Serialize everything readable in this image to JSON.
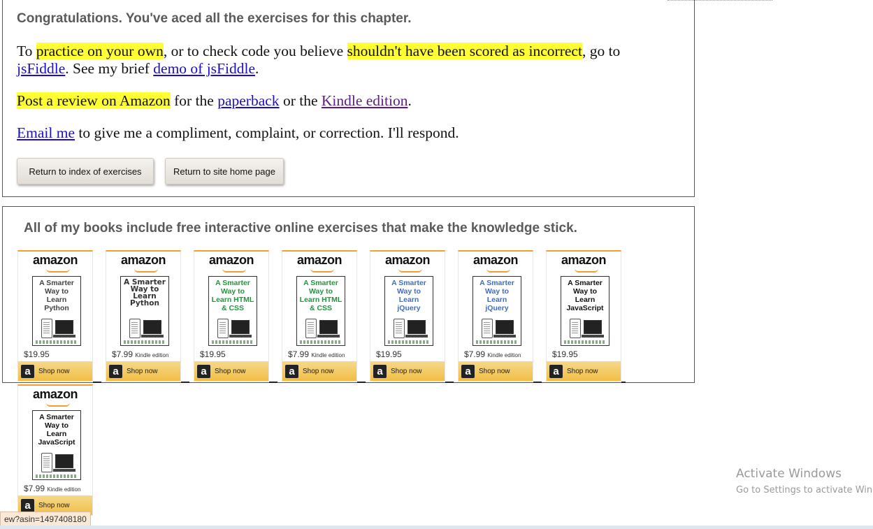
{
  "result": {
    "congrats": "Congratulations. You've aced all the exercises for this chapter.",
    "p1_to": "To ",
    "p1_practice": "practice on your own",
    "p1_mid": ", or to check code you believe ",
    "p1_incorrect": "shouldn't have been scored as incorrect",
    "p1_goto": ", go to",
    "p1_jsfiddle": "jsFiddle",
    "p1_see": ". See my brief ",
    "p1_demo": "demo of jsFiddle",
    "p1_end": ".",
    "p2_review": "Post a review on Amazon",
    "p2_for": " for the ",
    "p2_paperback": "paperback",
    "p2_or": " or the ",
    "p2_kindle": "Kindle edition",
    "p2_end": ".",
    "p3_email": "Email me",
    "p3_rest": " to give me a compliment, complaint, or correction. I'll respond.",
    "btn_index": "Return to index of exercises",
    "btn_home": "Return to site home page"
  },
  "books": {
    "heading": "All of my books include free interactive online exercises that make the knowledge stick.",
    "logo": "amazon",
    "shop_label": "Shop now",
    "items": [
      {
        "title": "A Smarter Way to Learn Python",
        "price": "$19.95",
        "edition": "",
        "color": "#444444"
      },
      {
        "title": "A Smarter Way to Learn Python",
        "price": "$7.99",
        "edition": "Kindle edition",
        "color": "#333333"
      },
      {
        "title": "A Smarter Way to Learn HTML & CSS",
        "price": "$19.95",
        "edition": "",
        "color": "#1a9a3a"
      },
      {
        "title": "A Smarter Way to Learn HTML & CSS",
        "price": "$7.99",
        "edition": "Kindle edition",
        "color": "#1a9a3a"
      },
      {
        "title": "A Smarter Way to Learn jQuery",
        "price": "$19.95",
        "edition": "",
        "color": "#3a6ec8"
      },
      {
        "title": "A Smarter Way to Learn jQuery",
        "price": "$7.99",
        "edition": "Kindle edition",
        "color": "#3a6ec8"
      },
      {
        "title": "A Smarter Way to Learn JavaScript",
        "price": "$19.95",
        "edition": "",
        "color": "#111111"
      },
      {
        "title": "A Smarter Way to Learn JavaScript",
        "price": "$7.99",
        "edition": "Kindle edition",
        "color": "#111111"
      }
    ]
  },
  "overlay": {
    "activate_title": "Activate Windows",
    "activate_sub": "Go to Settings to activate Windows.",
    "status_url": "ew?asin=1497408180"
  },
  "colors": {
    "highlight": "#ffff33",
    "link": "#1a0dcc",
    "visited_link": "#5a1a8a",
    "shop_button": "#f0be45"
  }
}
